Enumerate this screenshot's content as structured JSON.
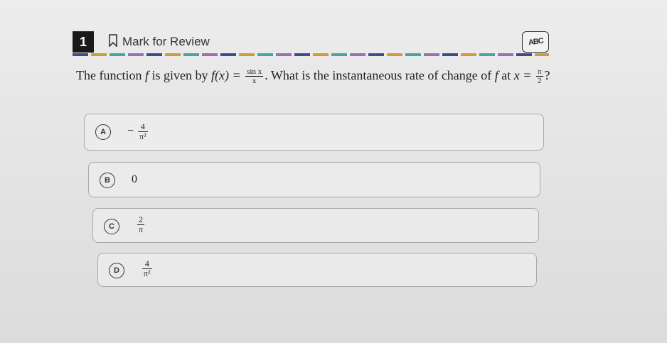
{
  "header": {
    "question_number": "1",
    "mark_for_review_label": "Mark for Review",
    "abc_label": "ABC"
  },
  "question": {
    "text_1": "The function ",
    "f1": "f",
    "text_2": " is given by ",
    "func": "f(x) =",
    "frac_num": "sin x",
    "frac_den": "x",
    "text_3": ". What is the instantaneous rate of change of ",
    "f2": "f",
    "text_4": " at ",
    "var": "x =",
    "frac2_num": "π",
    "frac2_den": "2",
    "text_5": "?"
  },
  "choices": [
    {
      "letter": "A",
      "sign": "−",
      "num": "4",
      "den": "π²"
    },
    {
      "letter": "B",
      "text": "0"
    },
    {
      "letter": "C",
      "num": "2",
      "den": "π"
    },
    {
      "letter": "D",
      "num": "4",
      "den": "π²"
    }
  ],
  "colors": {
    "accent_dash": [
      "#3f4b8a",
      "#d39a3a",
      "#4aa3a3",
      "#9a6fb3"
    ]
  },
  "icons": [
    "bookmark-icon",
    "abc-strikethrough-icon"
  ]
}
